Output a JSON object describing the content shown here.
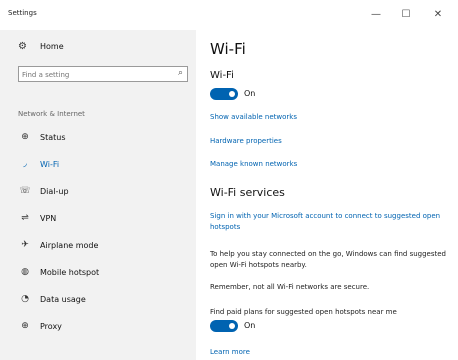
{
  "window": {
    "title": "Settings",
    "minimize_glyph": "—",
    "maximize_glyph": "☐",
    "close_glyph": "✕"
  },
  "sidebar": {
    "home_label": "Home",
    "search_placeholder": "Find a setting",
    "section_label": "Network & Internet",
    "items": [
      {
        "label": "Status",
        "icon": "globe-icon",
        "glyph": "⊕"
      },
      {
        "label": "Wi-Fi",
        "icon": "wifi-icon",
        "glyph": "◞",
        "active": true
      },
      {
        "label": "Dial-up",
        "icon": "phone-icon",
        "glyph": "☏"
      },
      {
        "label": "VPN",
        "icon": "vpn-icon",
        "glyph": "⇌"
      },
      {
        "label": "Airplane mode",
        "icon": "airplane-icon",
        "glyph": "✈"
      },
      {
        "label": "Mobile hotspot",
        "icon": "hotspot-icon",
        "glyph": "◍"
      },
      {
        "label": "Data usage",
        "icon": "data-usage-icon",
        "glyph": "◔"
      },
      {
        "label": "Proxy",
        "icon": "proxy-icon",
        "glyph": "⊕"
      }
    ]
  },
  "main": {
    "title": "Wi-Fi",
    "wifi_heading": "Wi-Fi",
    "wifi_toggle_label": "On",
    "links": {
      "show_networks": "Show available networks",
      "hardware_properties": "Hardware properties",
      "manage_networks": "Manage known networks"
    },
    "services_heading": "Wi-Fi services",
    "signin_link": "Sign in with your Microsoft account to connect to suggested open hotspots",
    "help_text": "To help you stay connected on the go, Windows can find suggested open Wi-Fi hotspots nearby.",
    "remember_text": "Remember, not all Wi-Fi networks are secure.",
    "paid_plans_text": "Find paid plans for suggested open hotspots near me",
    "paid_toggle_label": "On",
    "learn_more": "Learn more"
  },
  "colors": {
    "accent": "#0063b1",
    "sidebar_bg": "#f2f2f2"
  }
}
